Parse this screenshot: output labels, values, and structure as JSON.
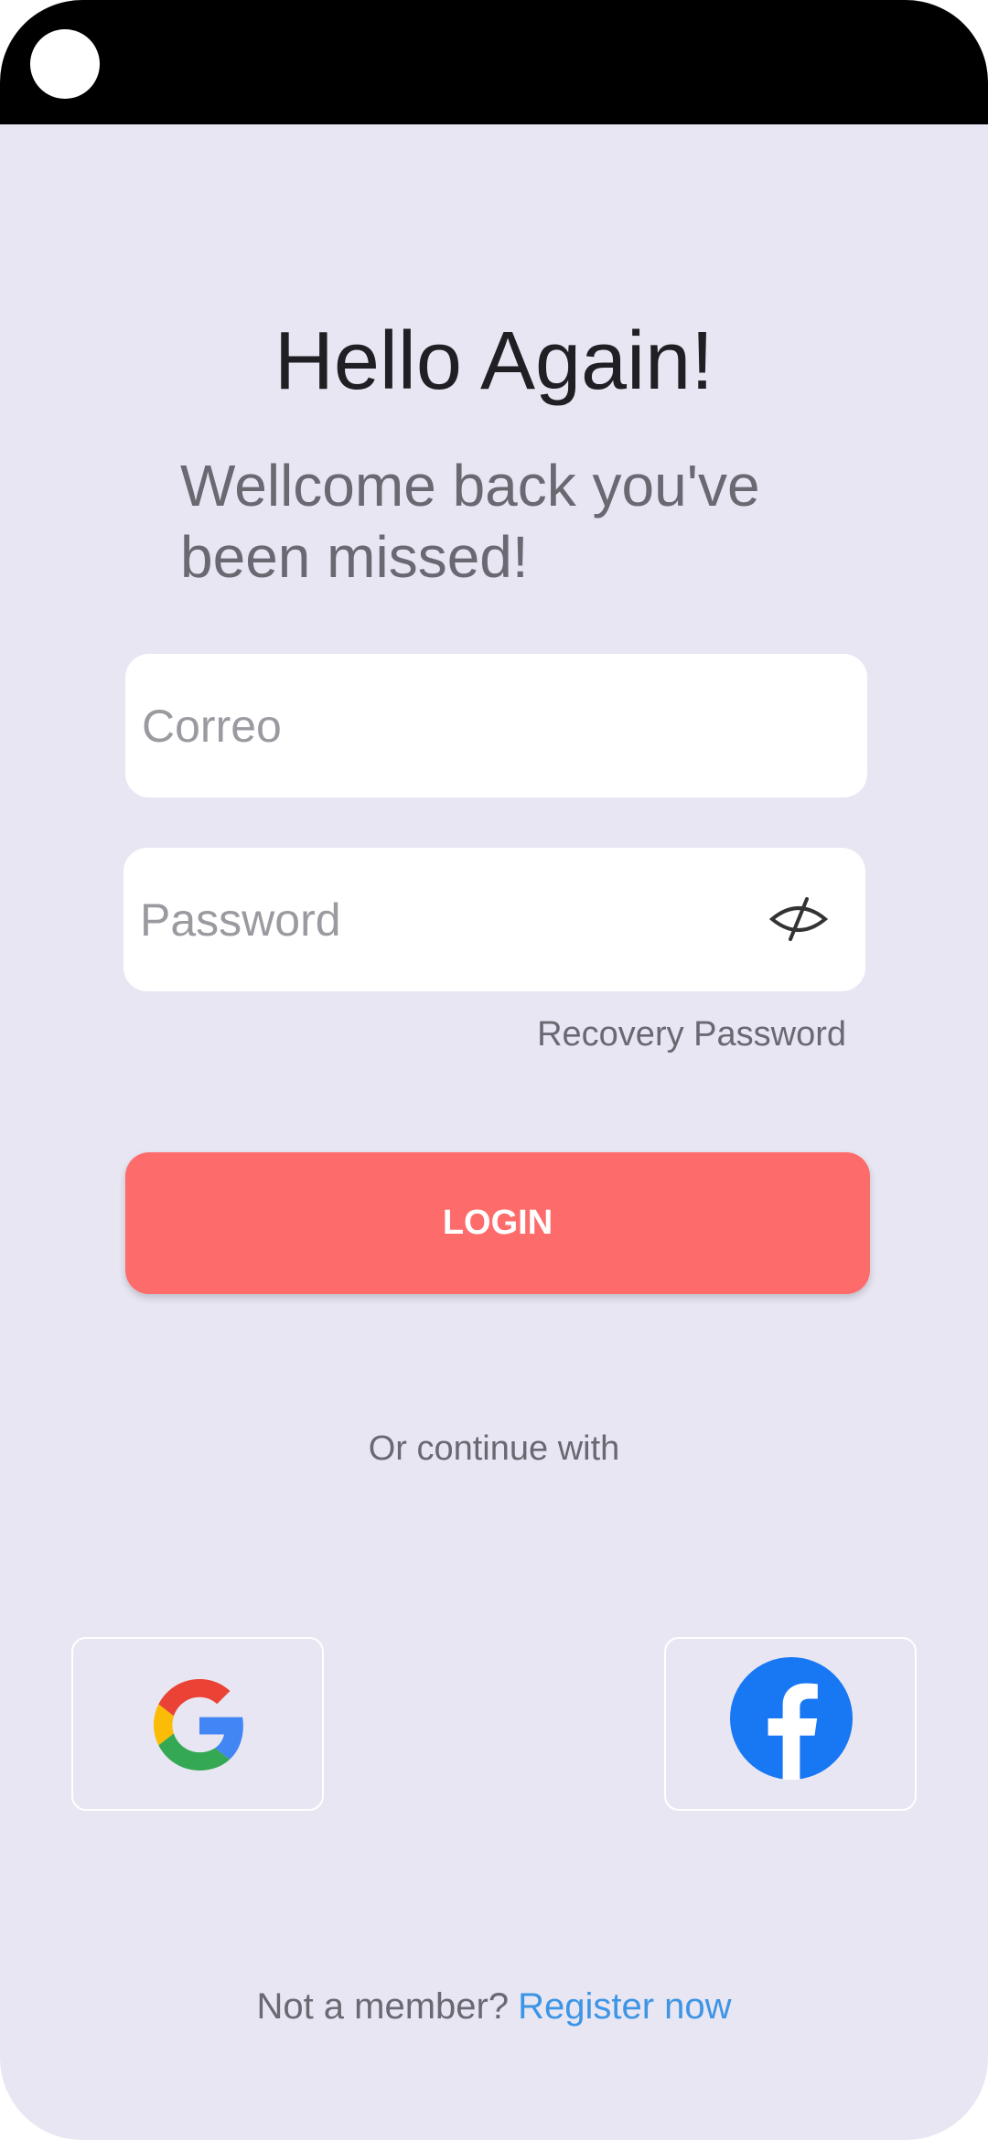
{
  "header": {
    "title": "Hello Again!",
    "subtitle": "Wellcome back you've been missed!"
  },
  "form": {
    "email_placeholder": "Correo",
    "password_placeholder": "Password",
    "password_toggle_icon": "eye-hidden-icon",
    "recovery_label": "Recovery Password",
    "login_label": "LOGIN"
  },
  "social": {
    "divider_text": "Or continue with",
    "providers": [
      {
        "name": "google",
        "icon": "google-icon"
      },
      {
        "name": "facebook",
        "icon": "facebook-icon"
      }
    ]
  },
  "footer": {
    "prompt": "Not a member?",
    "register_label": "Register now"
  },
  "colors": {
    "background": "#e8e6f2",
    "primary_button": "#fe6b6b",
    "link": "#3d95e6",
    "muted_text": "#6a6870"
  }
}
